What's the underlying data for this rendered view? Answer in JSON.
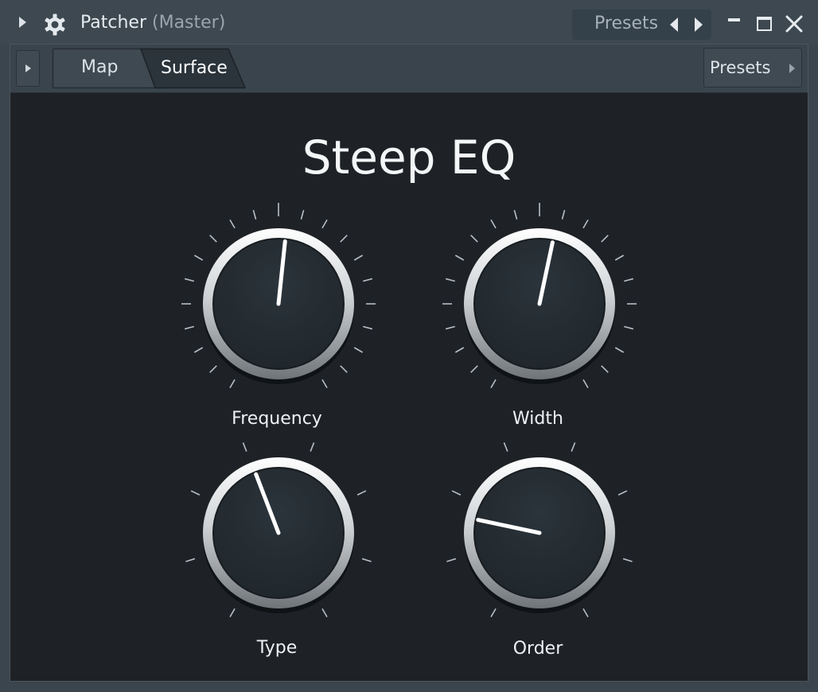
{
  "window": {
    "title": "Patcher",
    "subtitle": "(Master)",
    "presets_label": "Presets"
  },
  "toolbar": {
    "tabs": [
      {
        "label": "Map",
        "active": false
      },
      {
        "label": "Surface",
        "active": true
      }
    ],
    "presets_label": "Presets"
  },
  "surface": {
    "title": "Steep EQ",
    "knobs": [
      {
        "label": "Frequency",
        "value": 0.52,
        "scale": "continuous"
      },
      {
        "label": "Width",
        "value": 0.54,
        "scale": "continuous"
      },
      {
        "label": "Type",
        "value": 0.43,
        "scale": "stepped"
      },
      {
        "label": "Order",
        "value": 0.24,
        "scale": "stepped"
      }
    ]
  },
  "colors": {
    "accent": "#ffffff",
    "background": "#1e2226",
    "chrome": "#3d4850"
  },
  "icons": [
    "expand-arrow-icon",
    "gear-icon",
    "prev-arrow-icon",
    "next-arrow-icon",
    "minimize-icon",
    "maximize-icon",
    "close-icon"
  ]
}
